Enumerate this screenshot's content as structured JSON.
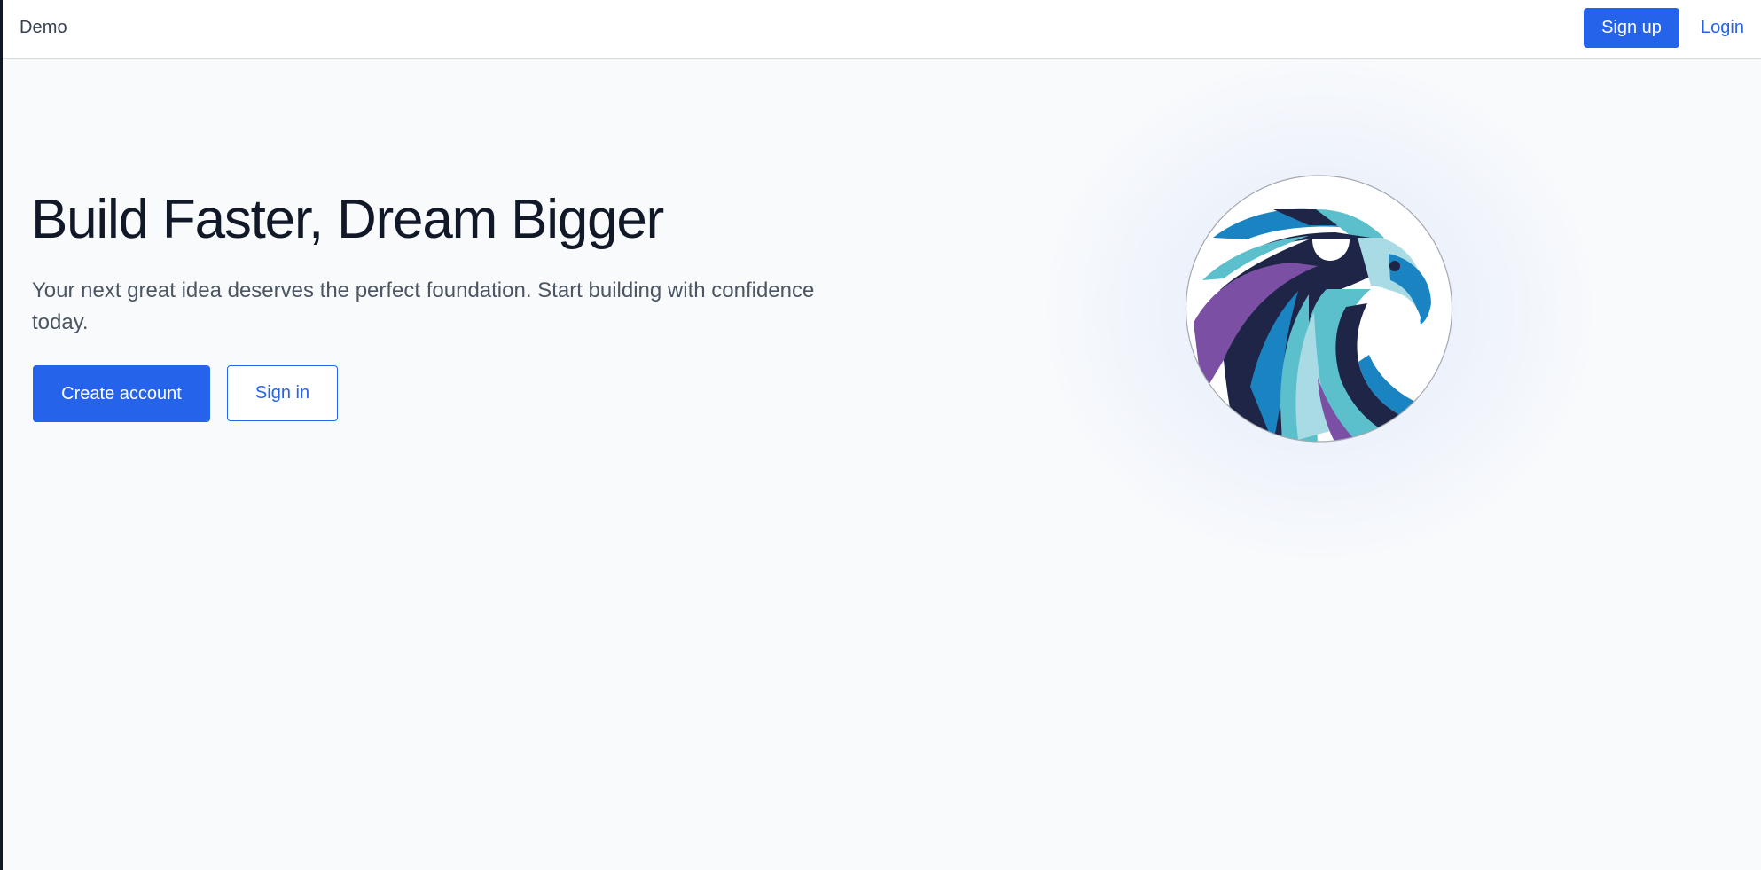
{
  "navbar": {
    "brand": "Demo",
    "signup_label": "Sign up",
    "login_label": "Login"
  },
  "hero": {
    "title": "Build Faster, Dream Bigger",
    "subtitle": "Your next great idea deserves the perfect foundation. Start building with confidence today.",
    "primary_cta": "Create account",
    "secondary_cta": "Sign in",
    "logo_icon": "eagle-logo-icon"
  },
  "colors": {
    "accent": "#2563eb",
    "heading": "#111827",
    "body_text": "#4b5563",
    "background": "#f8fafc",
    "logo_navy": "#1e2547",
    "logo_blue": "#1a84c2",
    "logo_teal": "#5bc0cc",
    "logo_light": "#a8dbe3",
    "logo_purple": "#7b4fa3"
  }
}
